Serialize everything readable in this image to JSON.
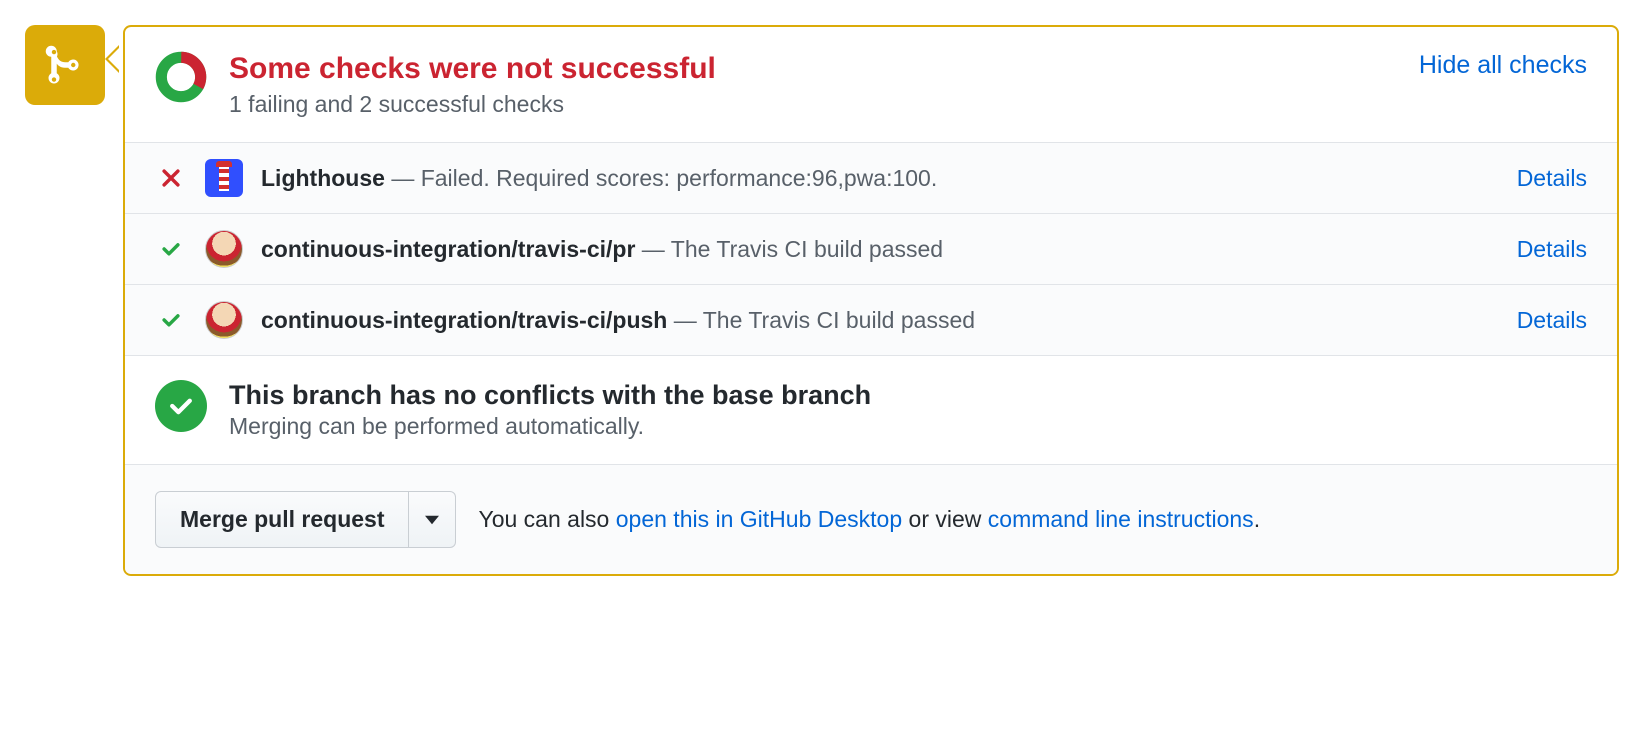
{
  "header": {
    "title": "Some checks were not successful",
    "summary": "1 failing and 2 successful checks",
    "hide_label": "Hide all checks"
  },
  "checks": [
    {
      "status": "fail",
      "avatar": "lighthouse",
      "name": "Lighthouse",
      "sep": " — ",
      "desc": "Failed. Required scores: performance:96,pwa:100.",
      "details": "Details"
    },
    {
      "status": "pass",
      "avatar": "travis",
      "name": "continuous-integration/travis-ci/pr",
      "sep": " — ",
      "desc": "The Travis CI build passed",
      "details": "Details"
    },
    {
      "status": "pass",
      "avatar": "travis",
      "name": "continuous-integration/travis-ci/push",
      "sep": " — ",
      "desc": "The Travis CI build passed",
      "details": "Details"
    }
  ],
  "conflict": {
    "title": "This branch has no conflicts with the base branch",
    "sub": "Merging can be performed automatically."
  },
  "footer": {
    "merge_label": "Merge pull request",
    "prefix": "You can also ",
    "link1": "open this in GitHub Desktop",
    "middle": " or view ",
    "link2": "command line instructions",
    "suffix": "."
  },
  "colors": {
    "accent": "#dbab09",
    "fail": "#cb2431",
    "pass": "#28a745",
    "link": "#0366d6"
  }
}
